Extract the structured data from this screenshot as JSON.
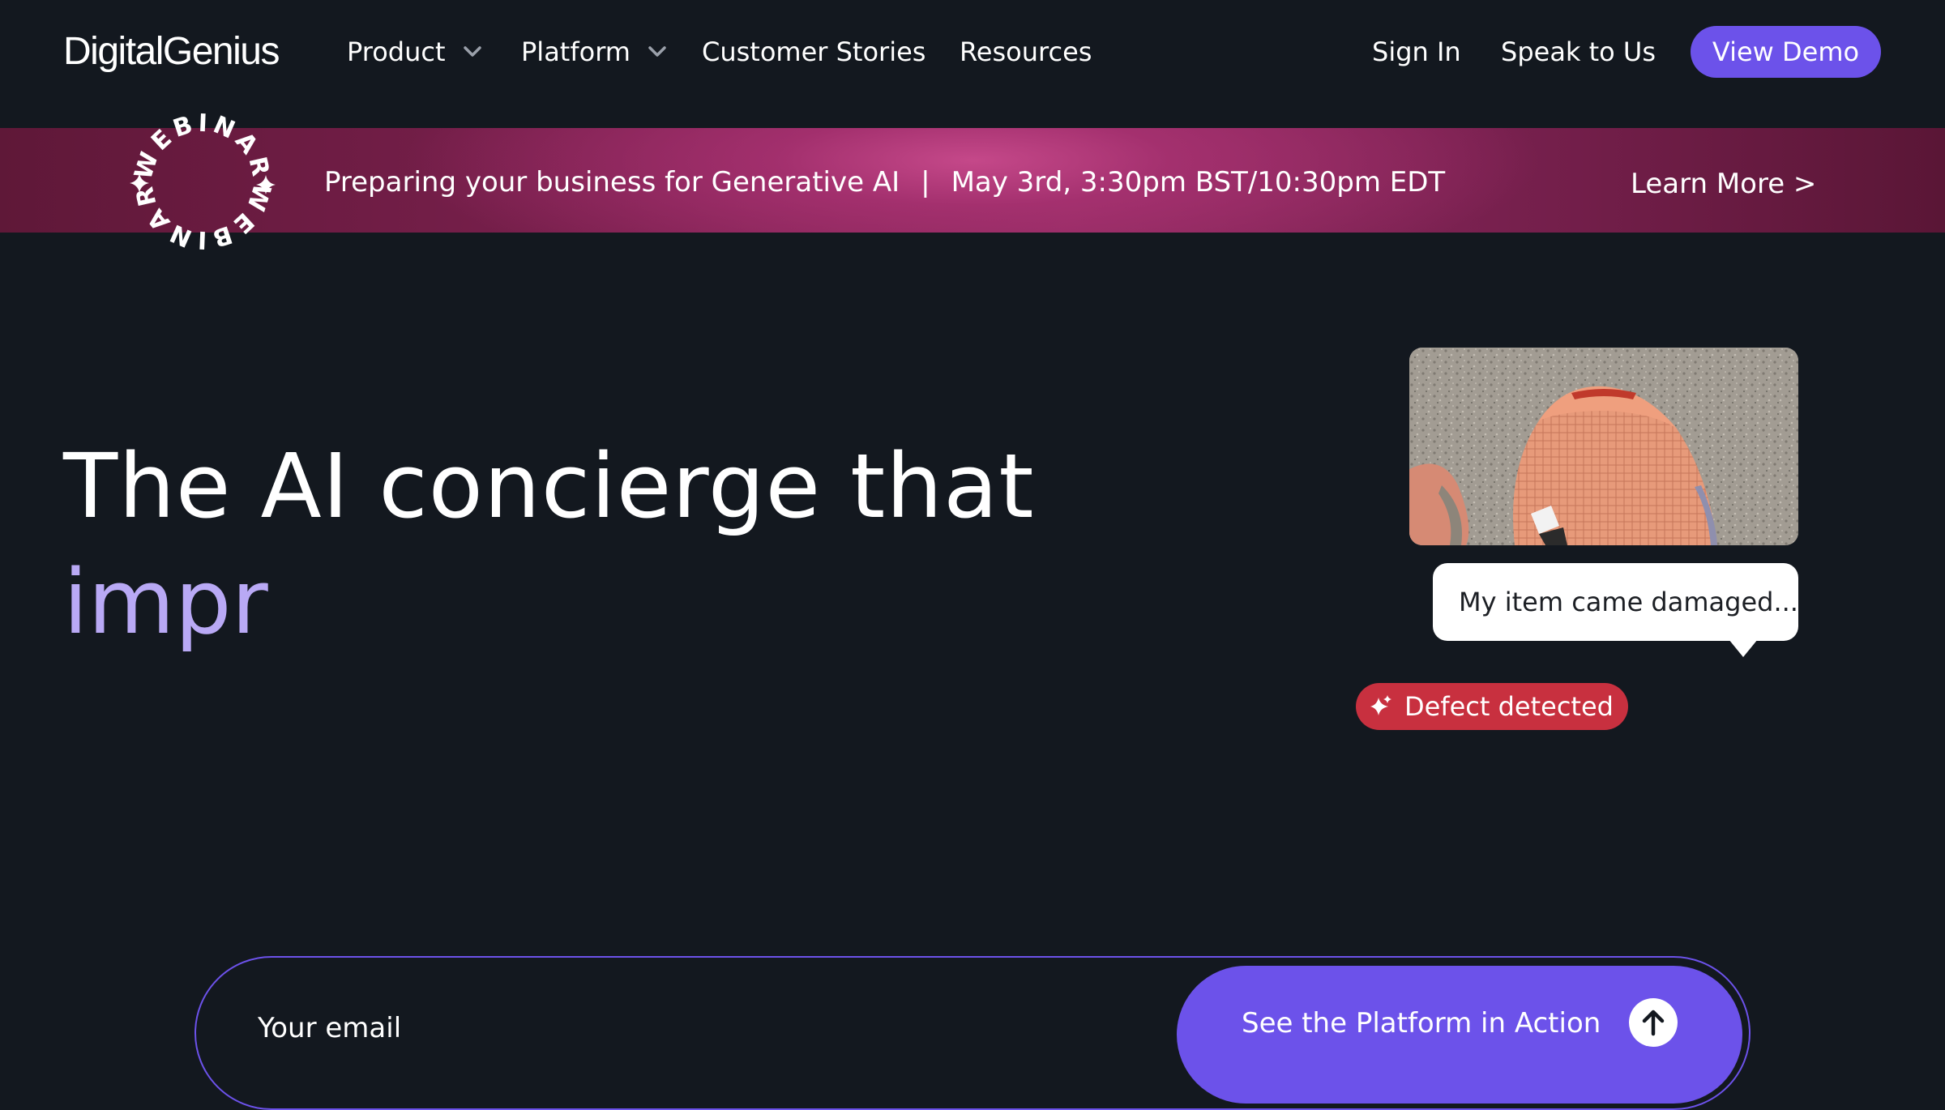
{
  "header": {
    "logo": "DigitalGenius",
    "nav": {
      "product": "Product",
      "platform": "Platform",
      "customer_stories": "Customer Stories",
      "resources": "Resources",
      "sign_in": "Sign In",
      "speak": "Speak to Us",
      "demo": "View Demo"
    }
  },
  "banner": {
    "badge_text": "WEBINAR",
    "title": "Preparing your business for Generative AI",
    "separator": "|",
    "date": "May 3rd, 3:30pm BST/10:30pm EDT",
    "cta": "Learn More >"
  },
  "hero": {
    "headline": "The AI concierge that",
    "headline_accent": "impr",
    "chat_message": "My item came damaged...",
    "detection_badge": "Defect detected",
    "email_placeholder": "Your email",
    "cta": "See the Platform in Action"
  },
  "colors": {
    "background": "#13181f",
    "accent": "#6c52ea",
    "accent_text": "#b9a9f5",
    "defect": "#c8303f"
  },
  "icons": [
    "chevron-down-icon",
    "star-sparkle-icon",
    "sparkle-icon",
    "arrow-up-icon"
  ]
}
